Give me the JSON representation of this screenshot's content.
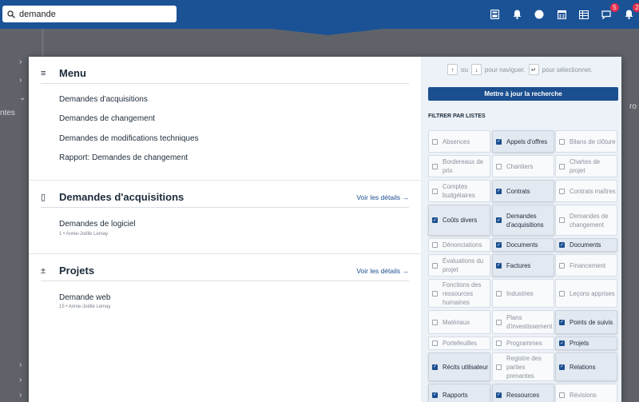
{
  "search": {
    "value": "demande"
  },
  "topbar": {
    "badge_chat": "5",
    "badge_notifications": "2"
  },
  "background": {
    "left_label": "ntes",
    "right_label": "ro"
  },
  "menu_section": {
    "title": "Menu",
    "items": [
      "Demandes d'acquisitions",
      "Demandes de changement",
      "Demandes de modifications techniques",
      "Rapport: Demandes de changement"
    ]
  },
  "acq_section": {
    "title": "Demandes d'acquisitions",
    "details": "Voir les détails",
    "items": [
      {
        "label": "Demandes de logiciel",
        "sub": "1 • Annie-Joëlle Lemay"
      }
    ]
  },
  "proj_section": {
    "title": "Projets",
    "details": "Voir les détails",
    "items": [
      {
        "label": "Demande web",
        "sub": "15 • Annie-Joëlle Lemay"
      }
    ]
  },
  "filter_panel": {
    "hint_or": "ou",
    "hint_navigate": "pour naviguer.",
    "hint_select": "pour sélectionner.",
    "update_label": "Mettre à jour la recherche",
    "filter_title": "FILTRER PAR LISTES",
    "rows": [
      [
        {
          "label": "Absences",
          "checked": false
        },
        {
          "label": "Appels d'offres",
          "checked": true
        },
        {
          "label": "Bilans de clôture",
          "checked": false
        }
      ],
      [
        {
          "label": "Bordereaux de prix",
          "checked": false
        },
        {
          "label": "Chantiers",
          "checked": false
        },
        {
          "label": "Chartes de projet",
          "checked": false
        }
      ],
      [
        {
          "label": "Comptes budgétaires",
          "checked": false
        },
        {
          "label": "Contrats",
          "checked": true
        },
        {
          "label": "Contrats maîtres",
          "checked": false
        }
      ],
      [
        {
          "label": "Coûts divers",
          "checked": true
        },
        {
          "label": "Demandes d'acquisitions",
          "checked": true
        },
        {
          "label": "Demandes de changement",
          "checked": false
        }
      ],
      [
        {
          "label": "Dénonciations",
          "checked": false
        },
        {
          "label": "Documents",
          "checked": true
        },
        {
          "label": "Documents",
          "checked": true
        }
      ],
      [
        {
          "label": "Évaluations du projet",
          "checked": false
        },
        {
          "label": "Factures",
          "checked": true
        },
        {
          "label": "Financement",
          "checked": false
        }
      ],
      [
        {
          "label": "Fonctions des ressources humaines",
          "checked": false
        },
        {
          "label": "Industries",
          "checked": false
        },
        {
          "label": "Leçons apprises",
          "checked": false
        }
      ],
      [
        {
          "label": "Matériaux",
          "checked": false
        },
        {
          "label": "Plans d'investissement",
          "checked": false
        },
        {
          "label": "Points de suivis",
          "checked": true
        }
      ],
      [
        {
          "label": "Portefeuilles",
          "checked": false
        },
        {
          "label": "Programmes",
          "checked": false
        },
        {
          "label": "Projets",
          "checked": true
        }
      ],
      [
        {
          "label": "Récits utilisateur",
          "checked": true
        },
        {
          "label": "Registre des parties prenantes",
          "checked": false
        },
        {
          "label": "Relations",
          "checked": true
        }
      ],
      [
        {
          "label": "Rapports",
          "checked": true
        },
        {
          "label": "Ressources",
          "checked": true
        },
        {
          "label": "Révisions",
          "checked": false
        }
      ]
    ]
  }
}
